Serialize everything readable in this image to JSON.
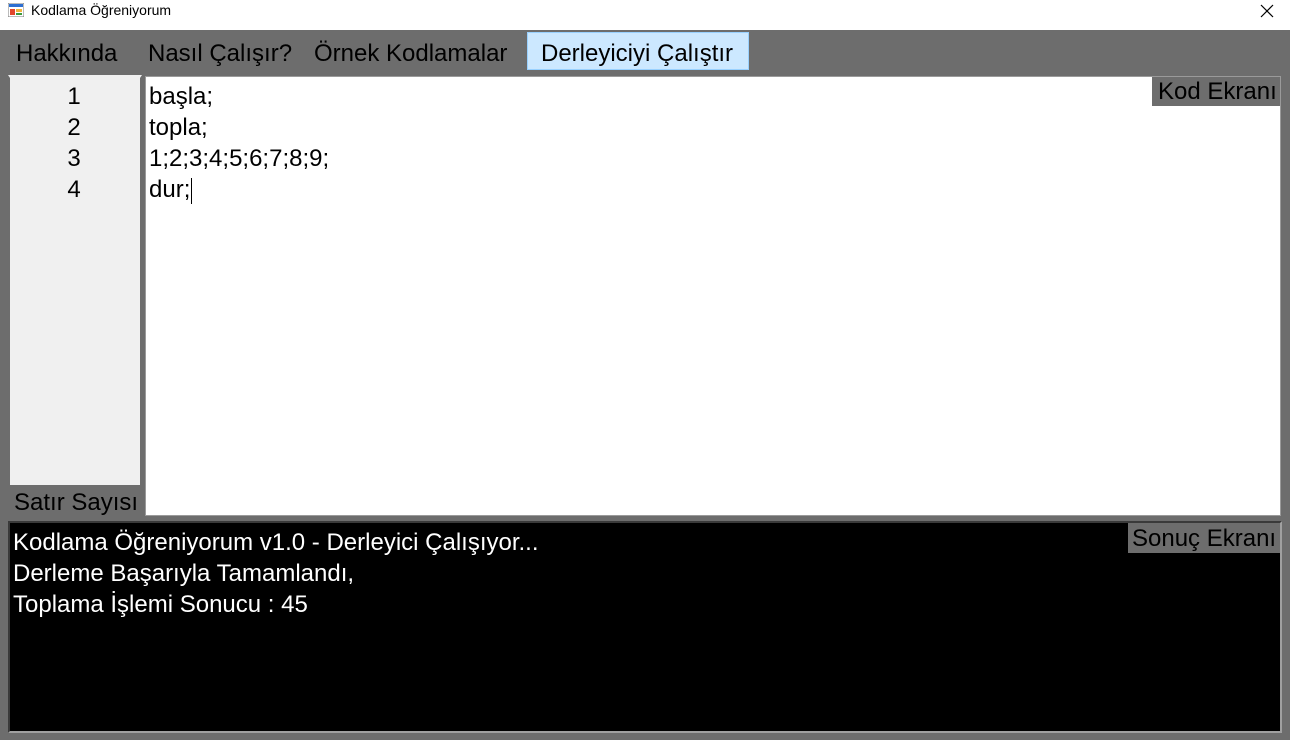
{
  "window": {
    "title": "Kodlama Öğreniyorum",
    "icon": "winforms-app-icon",
    "close_icon": "close-icon"
  },
  "menu": {
    "items": [
      {
        "label": "Hakkında"
      },
      {
        "label": "Nasıl Çalışır?"
      },
      {
        "label": "Örnek Kodlamalar"
      },
      {
        "label": "Derleyiciyi Çalıştır",
        "active": true
      }
    ]
  },
  "line_numbers": {
    "values": [
      "1",
      "2",
      "3",
      "4"
    ],
    "label": "Satır Sayısı"
  },
  "code_editor": {
    "label": "Kod Ekranı",
    "lines": [
      "başla;",
      "topla;",
      "1;2;3;4;5;6;7;8;9;",
      "dur;"
    ]
  },
  "result_screen": {
    "label": "Sonuç Ekranı",
    "lines": [
      "Kodlama Öğreniyorum v1.0 - Derleyici Çalışıyor...",
      "Derleme Başarıyla Tamamlandı,",
      "Toplama İşlemi Sonucu : 45"
    ]
  },
  "colors": {
    "background": "#6d6d6d",
    "active_menu": "#cce8ff",
    "editor_bg": "#ffffff",
    "result_bg": "#000000",
    "result_text": "#ffffff"
  }
}
